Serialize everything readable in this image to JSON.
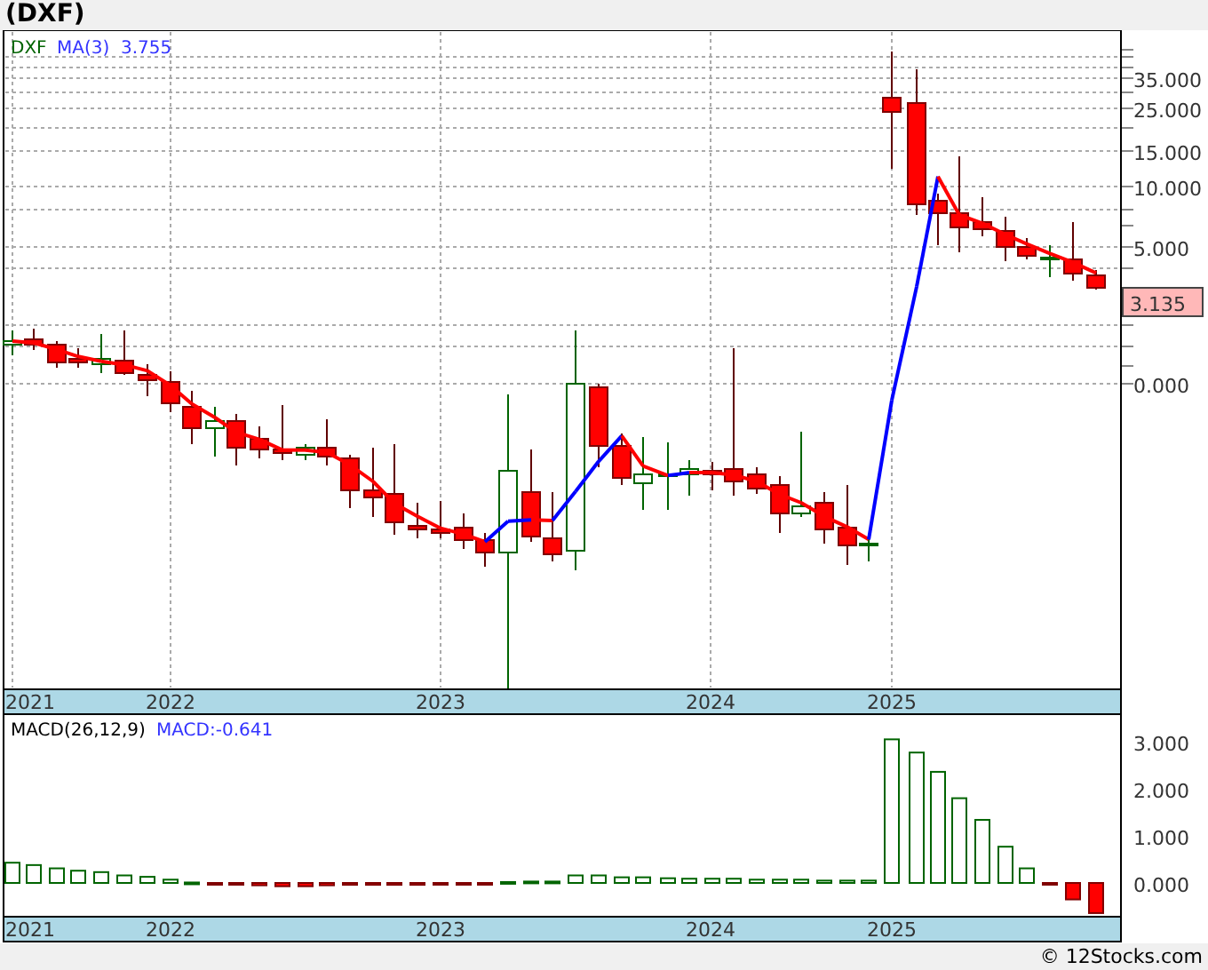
{
  "title": "(DXF)",
  "price_panel": {
    "legend": {
      "symbol": "DXF",
      "indicator": "MA(3)",
      "value": "3.755"
    },
    "y_axis": [
      "35.000",
      "25.000",
      "15.000",
      "10.000",
      "5.000",
      "0.000"
    ],
    "last_price": "3.135",
    "years": [
      "2021",
      "2022",
      "2023",
      "2024",
      "2025"
    ]
  },
  "macd_panel": {
    "legend": {
      "indicator": "MACD(26,12,9)",
      "value": "MACD:-0.641"
    },
    "y_axis": [
      "3.000",
      "2.000",
      "1.000",
      "0.000"
    ],
    "years": [
      "2021",
      "2022",
      "2023",
      "2024",
      "2025"
    ]
  },
  "footer": "© 12Stocks.com"
}
